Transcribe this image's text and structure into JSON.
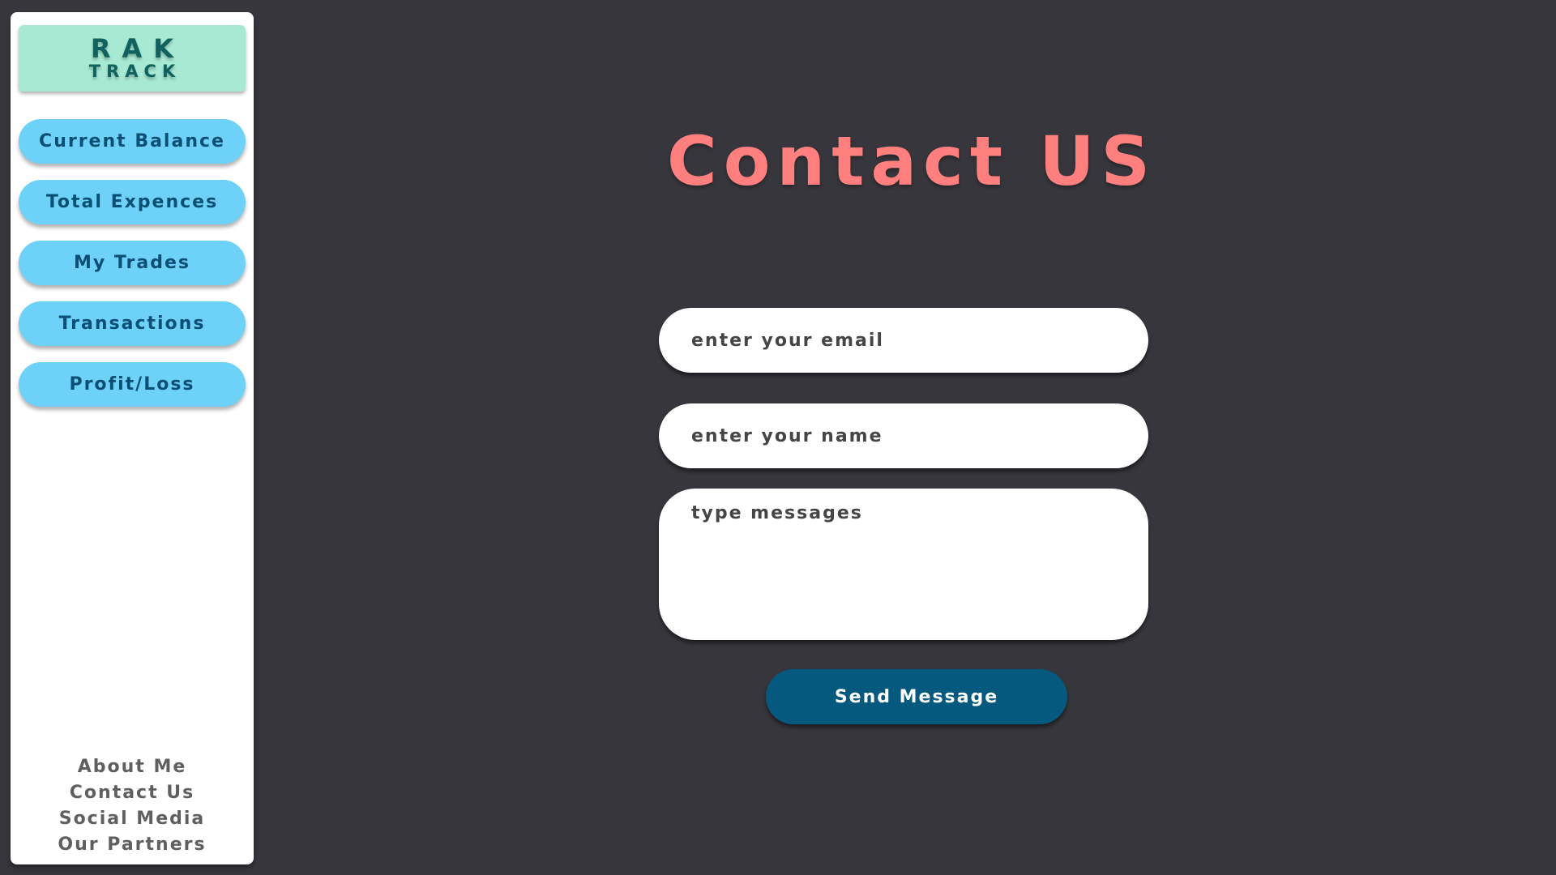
{
  "brand": {
    "line1": "RAK",
    "line2": "TRACK"
  },
  "sidebar": {
    "items": [
      {
        "label": "Current Balance"
      },
      {
        "label": "Total Expences"
      },
      {
        "label": "My Trades"
      },
      {
        "label": "Transactions"
      },
      {
        "label": "Profit/Loss"
      }
    ],
    "footer_links": [
      {
        "label": "About Me"
      },
      {
        "label": "Contact Us"
      },
      {
        "label": "Social Media"
      },
      {
        "label": "Our Partners"
      }
    ]
  },
  "main": {
    "title": "Contact US",
    "form": {
      "email_placeholder": "enter your email",
      "email_value": "",
      "name_placeholder": "enter your name",
      "name_value": "",
      "message_placeholder": "type messages",
      "message_value": "",
      "submit_label": "Send Message"
    }
  },
  "colors": {
    "background": "#36363c",
    "sidebar_bg": "#ffffff",
    "logo_bg": "#a8e9d3",
    "logo_text": "#10625e",
    "nav_button_bg": "#6ed2f8",
    "nav_button_text": "#0b4f74",
    "title": "#ff7f7f",
    "submit_bg": "#05597e"
  }
}
